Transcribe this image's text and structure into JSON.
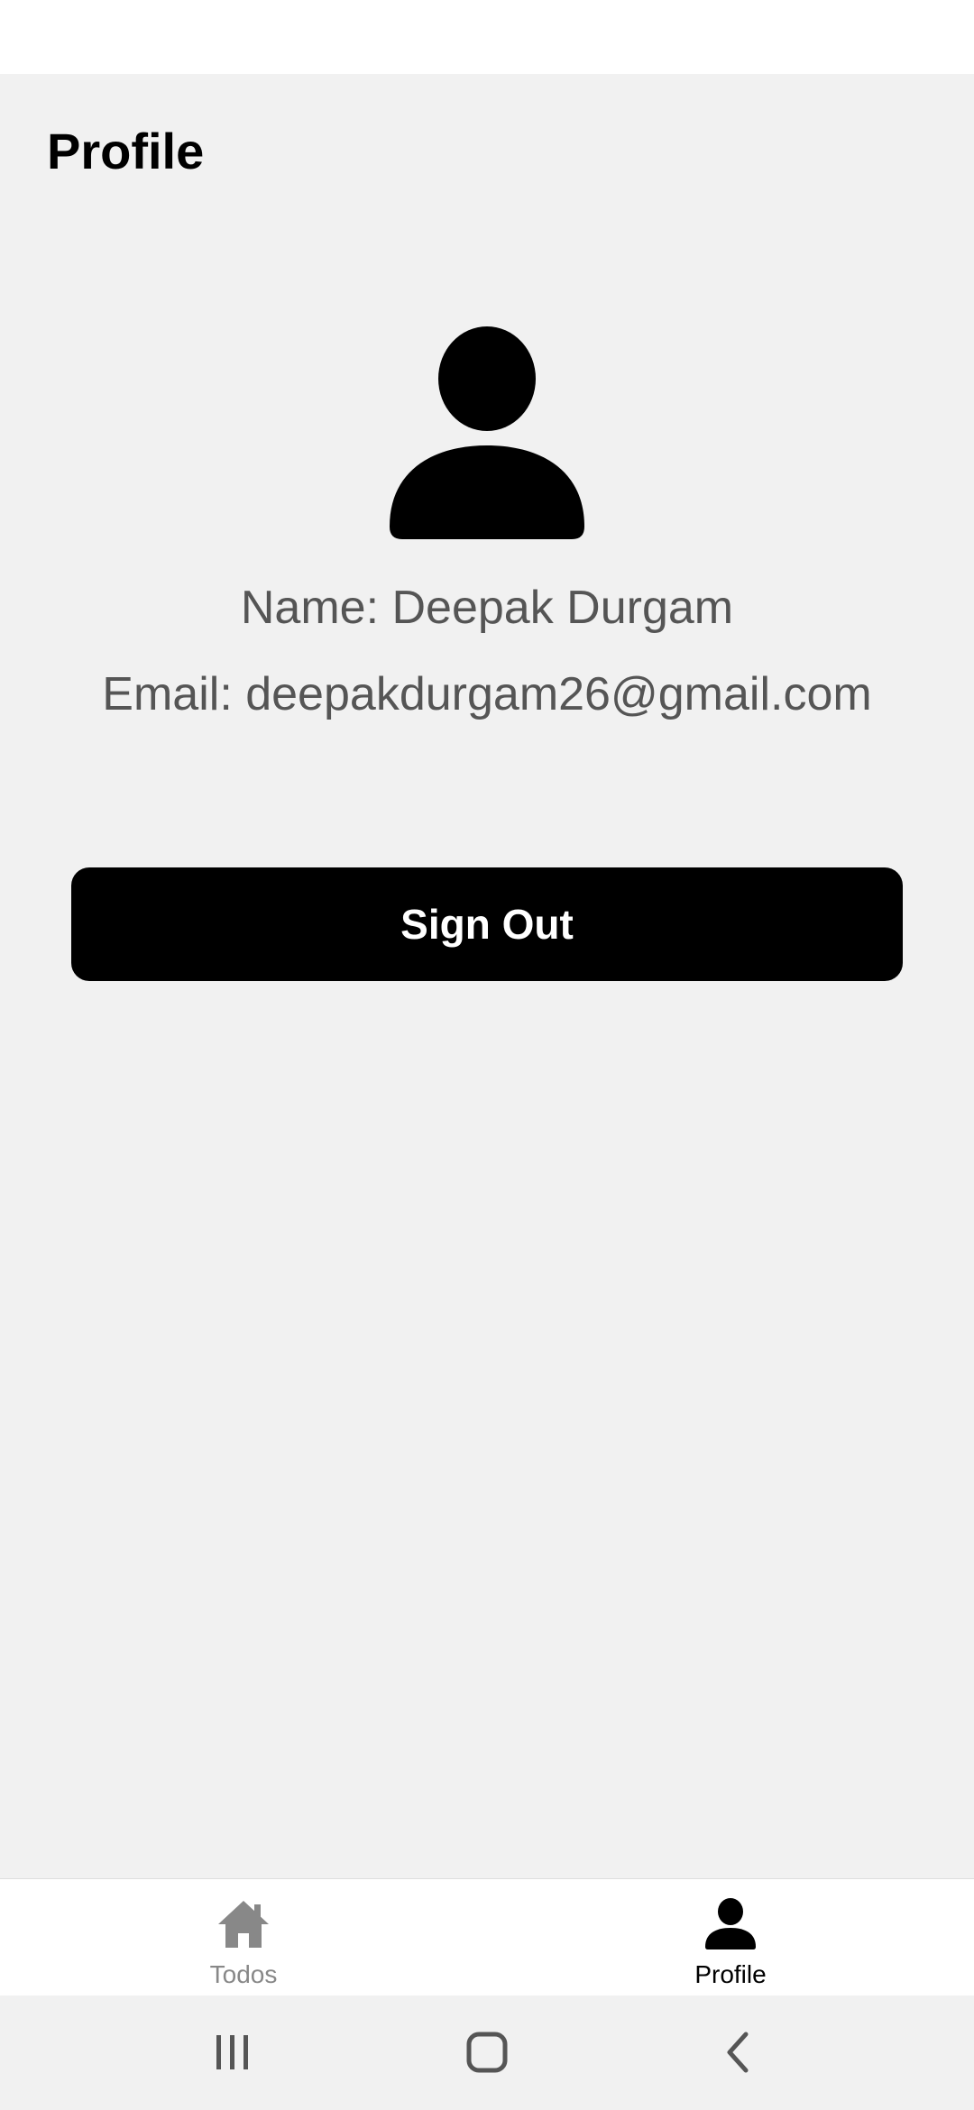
{
  "header": {
    "title": "Profile"
  },
  "user": {
    "name_line": "Name: Deepak Durgam",
    "email_line": "Email: deepakdurgam26@gmail.com",
    "avatar_icon": "person-icon"
  },
  "actions": {
    "sign_out_label": "Sign Out"
  },
  "tabs": [
    {
      "label": "Todos",
      "icon": "home-icon",
      "active": false
    },
    {
      "label": "Profile",
      "icon": "person-icon",
      "active": true
    }
  ],
  "colors": {
    "background": "#f1f1f1",
    "button": "#000000",
    "text_secondary": "#555555",
    "tab_inactive": "#888888",
    "tab_active": "#000000"
  },
  "system_nav": {
    "recents_icon": "recents-icon",
    "home_icon": "home-outline-icon",
    "back_icon": "back-chevron-icon"
  }
}
